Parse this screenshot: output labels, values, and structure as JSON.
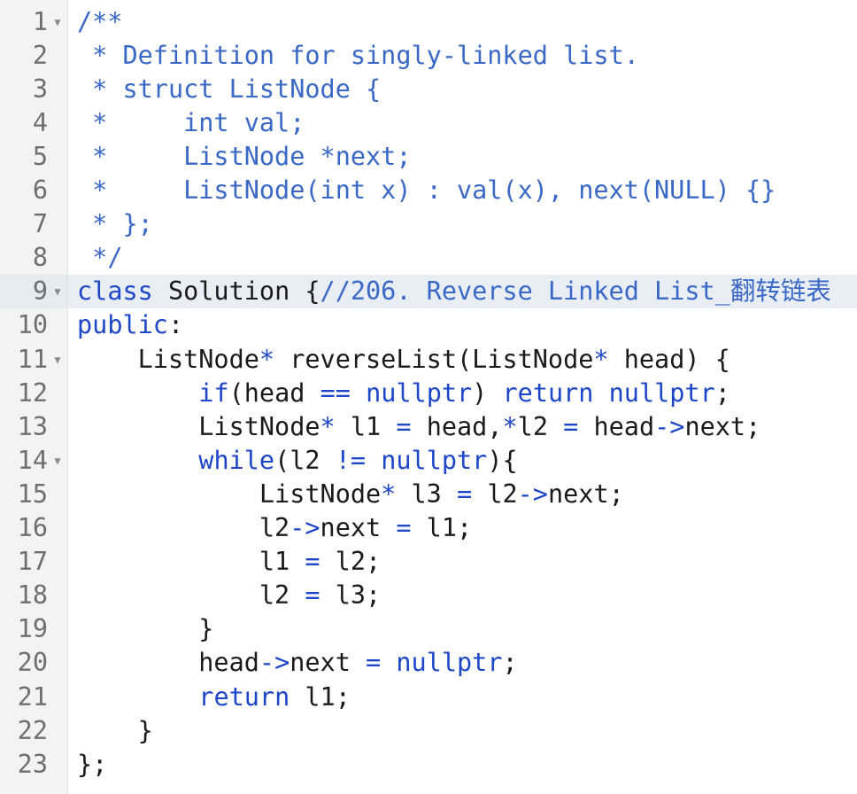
{
  "active_line": 9,
  "colors": {
    "keyword": "#1d46c9",
    "comment": "#3a68c6",
    "text": "#1a1a1a",
    "gutter_bg": "#f3f3f3",
    "line_number": "#6f6f6f",
    "active_line_bg": "#e9eef5"
  },
  "icons": {
    "fold": "caret-down-icon"
  },
  "fold_lines": [
    1,
    9,
    11,
    14
  ],
  "lines": [
    {
      "num": "1",
      "tokens": [
        {
          "t": "/**",
          "c": "cm"
        }
      ]
    },
    {
      "num": "2",
      "tokens": [
        {
          "t": " * Definition for singly-linked list.",
          "c": "cm"
        }
      ]
    },
    {
      "num": "3",
      "tokens": [
        {
          "t": " * struct ListNode {",
          "c": "cm"
        }
      ]
    },
    {
      "num": "4",
      "tokens": [
        {
          "t": " *     int val;",
          "c": "cm"
        }
      ]
    },
    {
      "num": "5",
      "tokens": [
        {
          "t": " *     ListNode *next;",
          "c": "cm"
        }
      ]
    },
    {
      "num": "6",
      "tokens": [
        {
          "t": " *     ListNode(int x) : val(x), next(NULL) {}",
          "c": "cm"
        }
      ]
    },
    {
      "num": "7",
      "tokens": [
        {
          "t": " * };",
          "c": "cm"
        }
      ]
    },
    {
      "num": "8",
      "tokens": [
        {
          "t": " */",
          "c": "cm"
        }
      ]
    },
    {
      "num": "9",
      "tokens": [
        {
          "t": "class",
          "c": "kw"
        },
        {
          "t": " Solution {",
          "c": ""
        },
        {
          "t": "//206. Reverse Linked List_翻转链表",
          "c": "cm"
        }
      ]
    },
    {
      "num": "10",
      "tokens": [
        {
          "t": "public",
          "c": "kw"
        },
        {
          "t": ":",
          "c": ""
        }
      ]
    },
    {
      "num": "11",
      "tokens": [
        {
          "t": "    ListNode",
          "c": ""
        },
        {
          "t": "*",
          "c": "op"
        },
        {
          "t": " reverseList(ListNode",
          "c": ""
        },
        {
          "t": "*",
          "c": "op"
        },
        {
          "t": " head) {",
          "c": ""
        }
      ]
    },
    {
      "num": "12",
      "tokens": [
        {
          "t": "        ",
          "c": ""
        },
        {
          "t": "if",
          "c": "kw"
        },
        {
          "t": "(head ",
          "c": ""
        },
        {
          "t": "==",
          "c": "op"
        },
        {
          "t": " ",
          "c": ""
        },
        {
          "t": "nullptr",
          "c": "kw"
        },
        {
          "t": ") ",
          "c": ""
        },
        {
          "t": "return",
          "c": "kw"
        },
        {
          "t": " ",
          "c": ""
        },
        {
          "t": "nullptr",
          "c": "kw"
        },
        {
          "t": ";",
          "c": ""
        }
      ]
    },
    {
      "num": "13",
      "tokens": [
        {
          "t": "        ListNode",
          "c": ""
        },
        {
          "t": "*",
          "c": "op"
        },
        {
          "t": " l1 ",
          "c": ""
        },
        {
          "t": "=",
          "c": "op"
        },
        {
          "t": " head,",
          "c": ""
        },
        {
          "t": "*",
          "c": "op"
        },
        {
          "t": "l2 ",
          "c": ""
        },
        {
          "t": "=",
          "c": "op"
        },
        {
          "t": " head",
          "c": ""
        },
        {
          "t": "->",
          "c": "op"
        },
        {
          "t": "next;",
          "c": ""
        }
      ]
    },
    {
      "num": "14",
      "tokens": [
        {
          "t": "        ",
          "c": ""
        },
        {
          "t": "while",
          "c": "kw"
        },
        {
          "t": "(l2 ",
          "c": ""
        },
        {
          "t": "!=",
          "c": "op"
        },
        {
          "t": " ",
          "c": ""
        },
        {
          "t": "nullptr",
          "c": "kw"
        },
        {
          "t": "){",
          "c": ""
        }
      ]
    },
    {
      "num": "15",
      "tokens": [
        {
          "t": "            ListNode",
          "c": ""
        },
        {
          "t": "*",
          "c": "op"
        },
        {
          "t": " l3 ",
          "c": ""
        },
        {
          "t": "=",
          "c": "op"
        },
        {
          "t": " l2",
          "c": ""
        },
        {
          "t": "->",
          "c": "op"
        },
        {
          "t": "next;",
          "c": ""
        }
      ]
    },
    {
      "num": "16",
      "tokens": [
        {
          "t": "            l2",
          "c": ""
        },
        {
          "t": "->",
          "c": "op"
        },
        {
          "t": "next ",
          "c": ""
        },
        {
          "t": "=",
          "c": "op"
        },
        {
          "t": " l1;",
          "c": ""
        }
      ]
    },
    {
      "num": "17",
      "tokens": [
        {
          "t": "            l1 ",
          "c": ""
        },
        {
          "t": "=",
          "c": "op"
        },
        {
          "t": " l2;",
          "c": ""
        }
      ]
    },
    {
      "num": "18",
      "tokens": [
        {
          "t": "            l2 ",
          "c": ""
        },
        {
          "t": "=",
          "c": "op"
        },
        {
          "t": " l3;",
          "c": ""
        }
      ]
    },
    {
      "num": "19",
      "tokens": [
        {
          "t": "        }",
          "c": ""
        }
      ]
    },
    {
      "num": "20",
      "tokens": [
        {
          "t": "        head",
          "c": ""
        },
        {
          "t": "->",
          "c": "op"
        },
        {
          "t": "next ",
          "c": ""
        },
        {
          "t": "=",
          "c": "op"
        },
        {
          "t": " ",
          "c": ""
        },
        {
          "t": "nullptr",
          "c": "kw"
        },
        {
          "t": ";",
          "c": ""
        }
      ]
    },
    {
      "num": "21",
      "tokens": [
        {
          "t": "        ",
          "c": ""
        },
        {
          "t": "return",
          "c": "kw"
        },
        {
          "t": " l1;",
          "c": ""
        }
      ]
    },
    {
      "num": "22",
      "tokens": [
        {
          "t": "    }",
          "c": ""
        }
      ]
    },
    {
      "num": "23",
      "tokens": [
        {
          "t": "};",
          "c": ""
        }
      ]
    }
  ]
}
